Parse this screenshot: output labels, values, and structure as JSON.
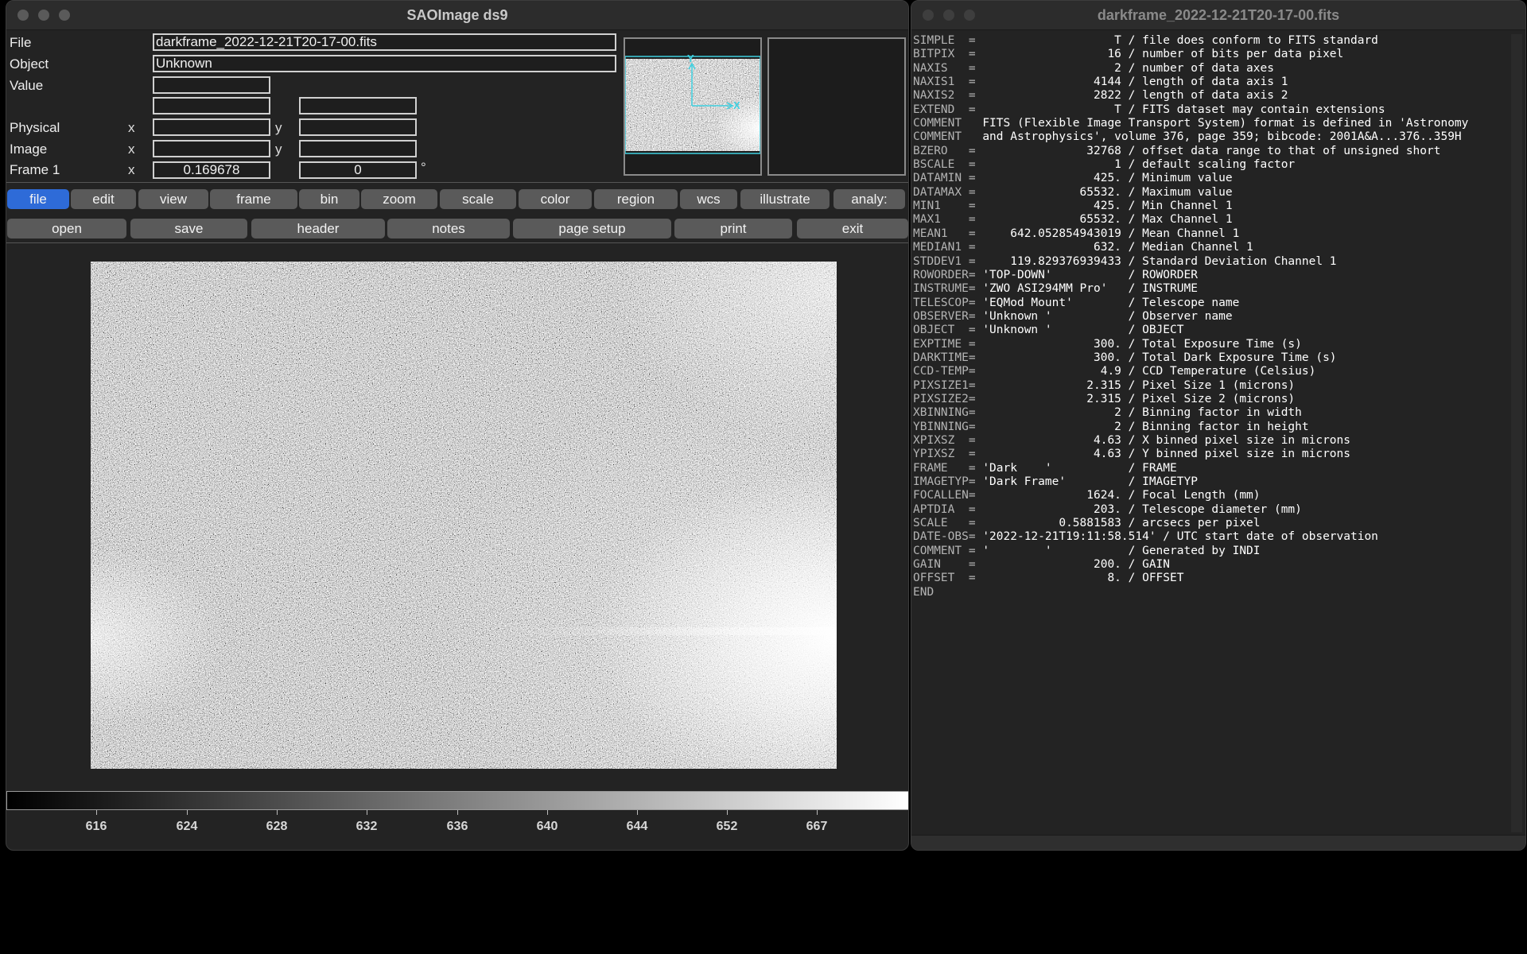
{
  "ds9": {
    "title": "SAOImage ds9",
    "info": {
      "file_label": "File",
      "file_value": "darkframe_2022-12-21T20-17-00.fits",
      "object_label": "Object",
      "object_value": "Unknown",
      "value_label": "Value",
      "value": "",
      "physical_label": "Physical",
      "image_label": "Image",
      "frame_label": "Frame 1",
      "x_label": "x",
      "y_label": "y",
      "frame_zoom": "0.169678",
      "frame_angle": "0",
      "degree_symbol": "°"
    },
    "panner": {
      "axis_y": "Y",
      "axis_x": "X"
    },
    "menu": [
      {
        "label": "file"
      },
      {
        "label": "edit"
      },
      {
        "label": "view"
      },
      {
        "label": "frame"
      },
      {
        "label": "bin"
      },
      {
        "label": "zoom"
      },
      {
        "label": "scale"
      },
      {
        "label": "color"
      },
      {
        "label": "region"
      },
      {
        "label": "wcs"
      },
      {
        "label": "illustrate"
      },
      {
        "label": "analy:"
      }
    ],
    "file_buttons": [
      {
        "label": "open"
      },
      {
        "label": "save"
      },
      {
        "label": "header"
      },
      {
        "label": "notes"
      },
      {
        "label": "page setup"
      },
      {
        "label": "print"
      },
      {
        "label": "exit"
      }
    ],
    "colorbar_ticks": [
      "616",
      "624",
      "628",
      "632",
      "636",
      "640",
      "644",
      "652",
      "667"
    ]
  },
  "header_window": {
    "title": "darkframe_2022-12-21T20-17-00.fits",
    "lines": [
      {
        "k": "SIMPLE  = ",
        "v": "                   T / file does conform to FITS standard"
      },
      {
        "k": "BITPIX  = ",
        "v": "                  16 / number of bits per data pixel"
      },
      {
        "k": "NAXIS   = ",
        "v": "                   2 / number of data axes"
      },
      {
        "k": "NAXIS1  = ",
        "v": "                4144 / length of data axis 1"
      },
      {
        "k": "NAXIS2  = ",
        "v": "                2822 / length of data axis 2"
      },
      {
        "k": "EXTEND  = ",
        "v": "                   T / FITS dataset may contain extensions"
      },
      {
        "k": "COMMENT   ",
        "v": "FITS (Flexible Image Transport System) format is defined in 'Astronomy"
      },
      {
        "k": "COMMENT   ",
        "v": "and Astrophysics', volume 376, page 359; bibcode: 2001A&A...376..359H"
      },
      {
        "k": "BZERO   = ",
        "v": "               32768 / offset data range to that of unsigned short"
      },
      {
        "k": "BSCALE  = ",
        "v": "                   1 / default scaling factor"
      },
      {
        "k": "DATAMIN = ",
        "v": "                425. / Minimum value"
      },
      {
        "k": "DATAMAX = ",
        "v": "              65532. / Maximum value"
      },
      {
        "k": "MIN1    = ",
        "v": "                425. / Min Channel 1"
      },
      {
        "k": "MAX1    = ",
        "v": "              65532. / Max Channel 1"
      },
      {
        "k": "MEAN1   = ",
        "v": "    642.052854943019 / Mean Channel 1"
      },
      {
        "k": "MEDIAN1 = ",
        "v": "                632. / Median Channel 1"
      },
      {
        "k": "STDDEV1 = ",
        "v": "    119.829376939433 / Standard Deviation Channel 1"
      },
      {
        "k": "ROWORDER= ",
        "v": "'TOP-DOWN'           / ROWORDER"
      },
      {
        "k": "INSTRUME= ",
        "v": "'ZWO ASI294MM Pro'   / INSTRUME"
      },
      {
        "k": "TELESCOP= ",
        "v": "'EQMod Mount'        / Telescope name"
      },
      {
        "k": "OBSERVER= ",
        "v": "'Unknown '           / Observer name"
      },
      {
        "k": "OBJECT  = ",
        "v": "'Unknown '           / OBJECT"
      },
      {
        "k": "EXPTIME = ",
        "v": "                300. / Total Exposure Time (s)"
      },
      {
        "k": "DARKTIME= ",
        "v": "                300. / Total Dark Exposure Time (s)"
      },
      {
        "k": "CCD-TEMP= ",
        "v": "                 4.9 / CCD Temperature (Celsius)"
      },
      {
        "k": "PIXSIZE1= ",
        "v": "               2.315 / Pixel Size 1 (microns)"
      },
      {
        "k": "PIXSIZE2= ",
        "v": "               2.315 / Pixel Size 2 (microns)"
      },
      {
        "k": "XBINNING= ",
        "v": "                   2 / Binning factor in width"
      },
      {
        "k": "YBINNING= ",
        "v": "                   2 / Binning factor in height"
      },
      {
        "k": "XPIXSZ  = ",
        "v": "                4.63 / X binned pixel size in microns"
      },
      {
        "k": "YPIXSZ  = ",
        "v": "                4.63 / Y binned pixel size in microns"
      },
      {
        "k": "FRAME   = ",
        "v": "'Dark    '           / FRAME"
      },
      {
        "k": "IMAGETYP= ",
        "v": "'Dark Frame'         / IMAGETYP"
      },
      {
        "k": "FOCALLEN= ",
        "v": "               1624. / Focal Length (mm)"
      },
      {
        "k": "APTDIA  = ",
        "v": "                203. / Telescope diameter (mm)"
      },
      {
        "k": "SCALE   = ",
        "v": "           0.5881583 / arcsecs per pixel"
      },
      {
        "k": "DATE-OBS= ",
        "v": "'2022-12-21T19:11:58.514' / UTC start date of observation"
      },
      {
        "k": "COMMENT = ",
        "v": "'        '           / Generated by INDI"
      },
      {
        "k": "GAIN    = ",
        "v": "                200. / GAIN"
      },
      {
        "k": "OFFSET  = ",
        "v": "                  8. / OFFSET"
      },
      {
        "k": "END",
        "v": ""
      }
    ]
  },
  "colors": {
    "window_bg": "#232323",
    "active_menu": "#2e6bd8",
    "button_bg": "#5a5a5a",
    "crosshair": "#3fd0e0"
  }
}
